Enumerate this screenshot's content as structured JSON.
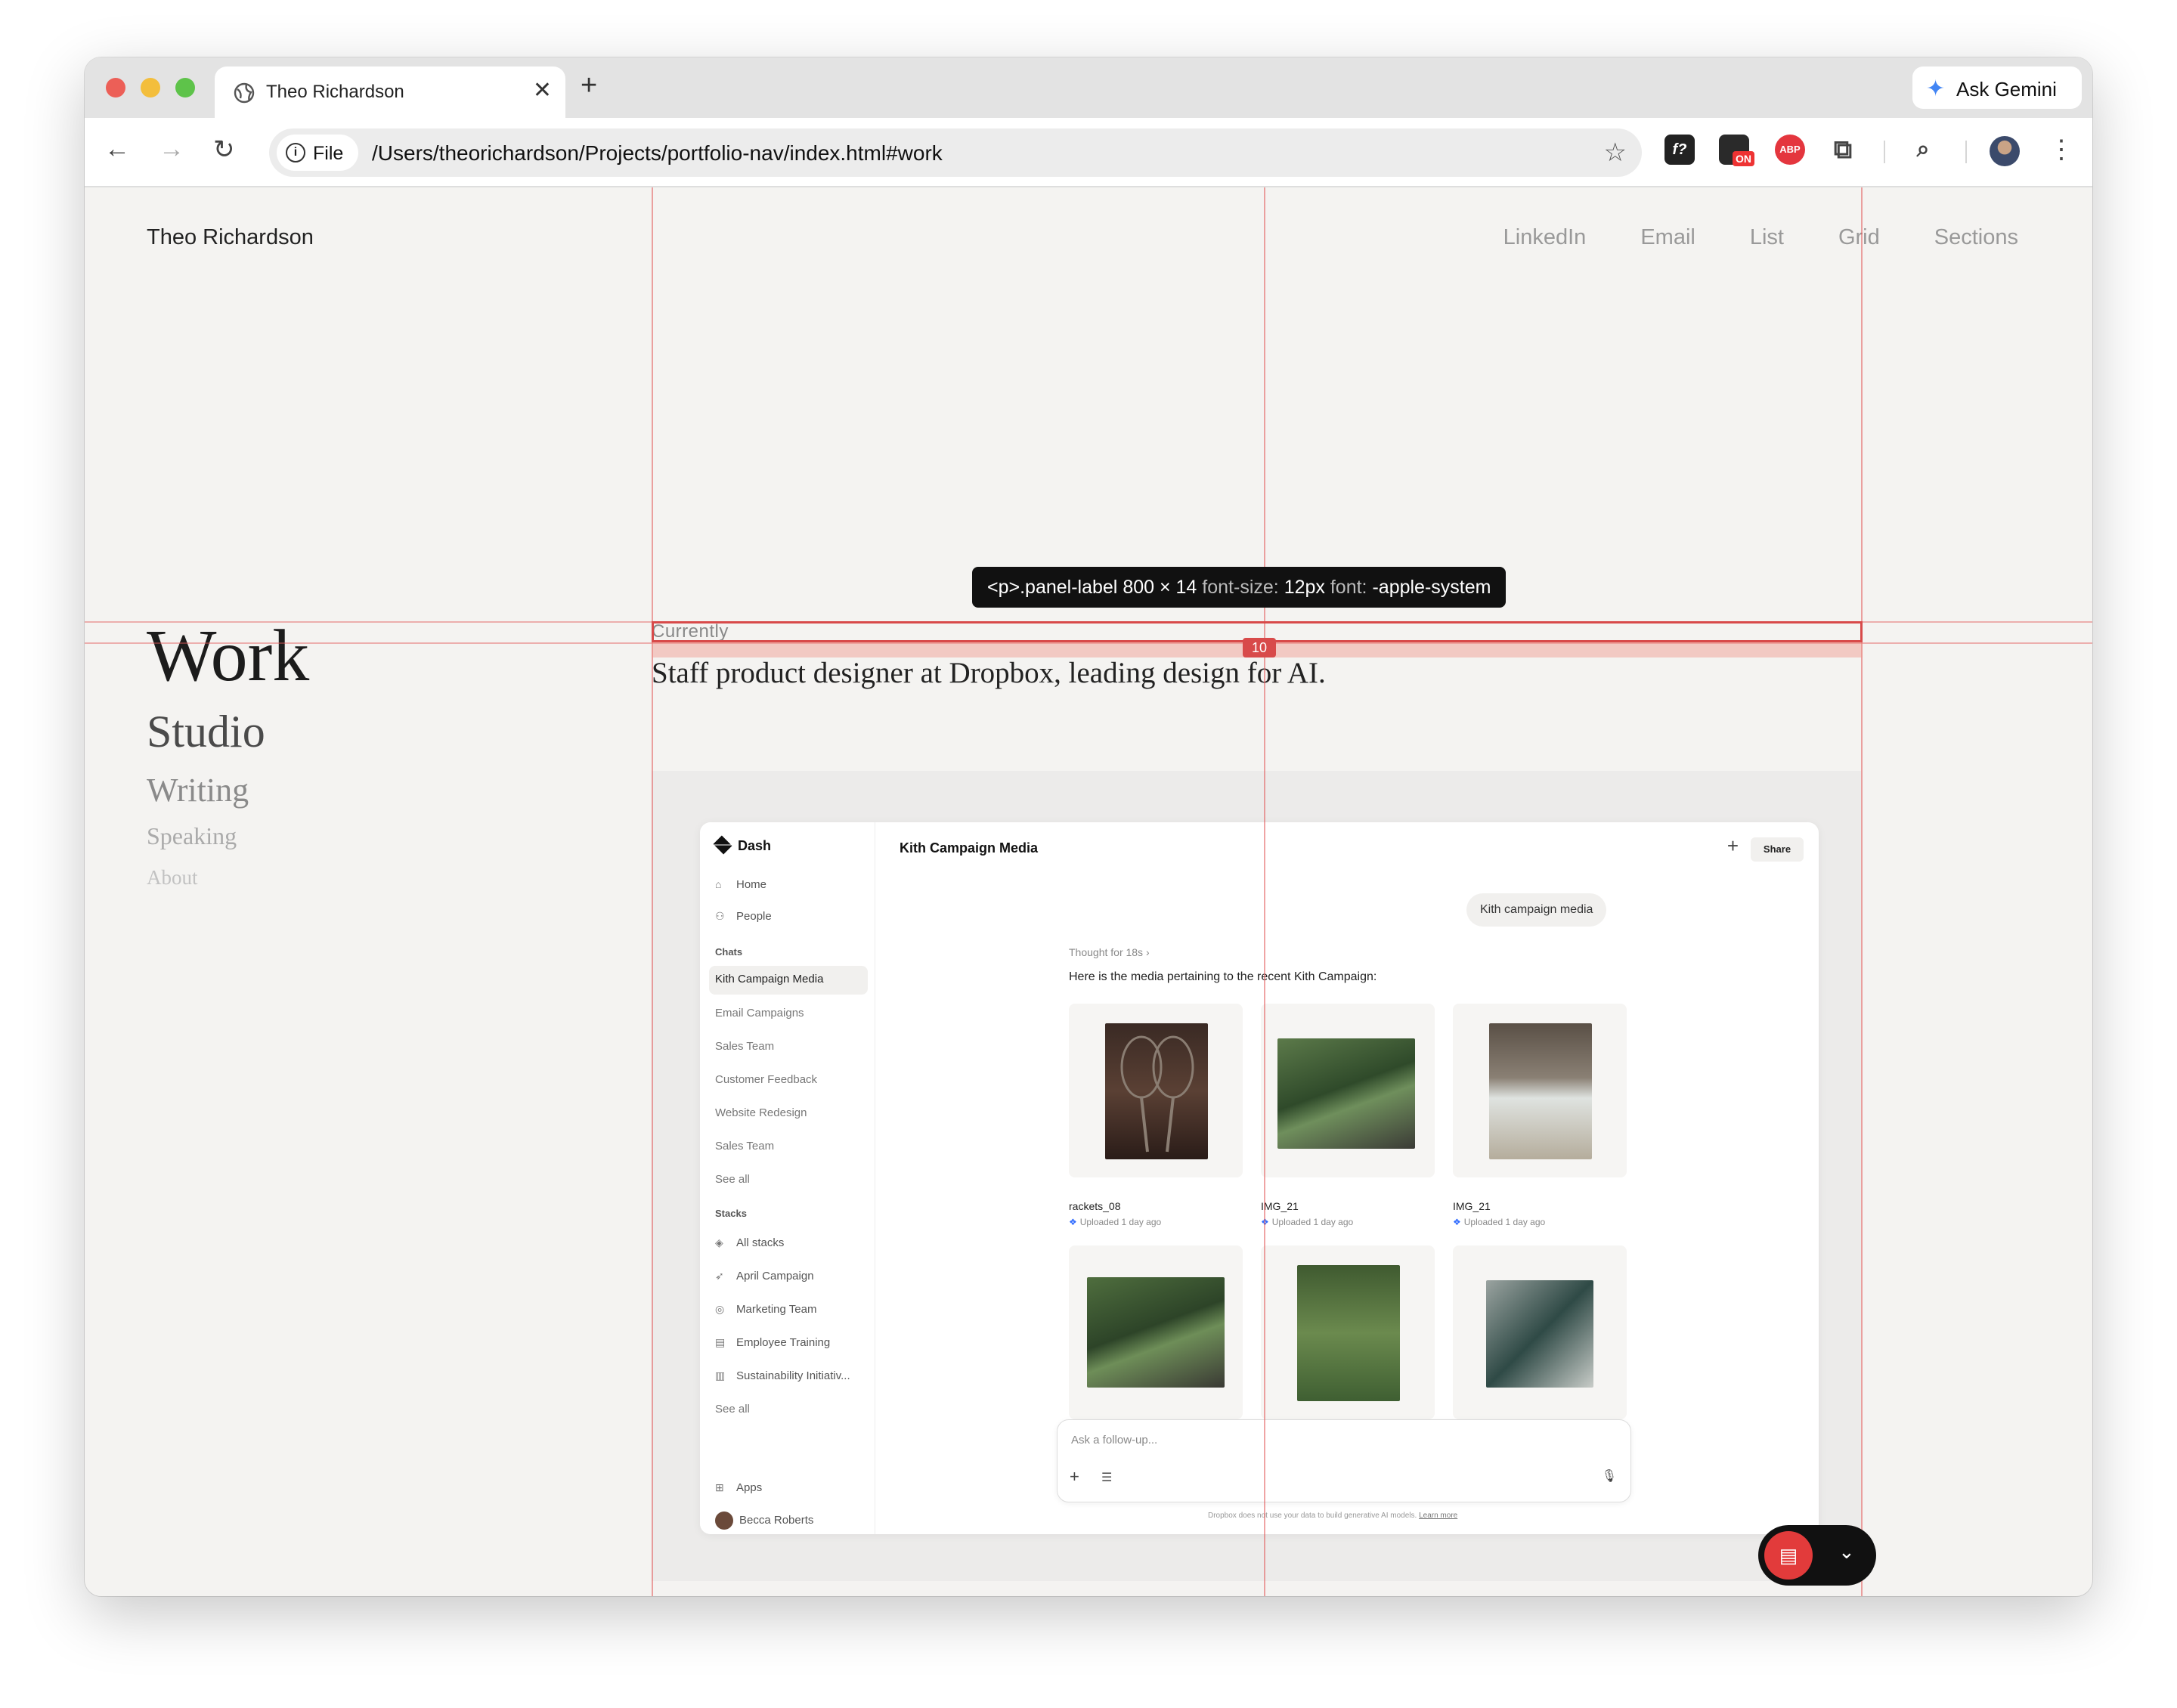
{
  "browser": {
    "tab_title": "Theo Richardson",
    "tab_close": "✕",
    "new_tab": "+",
    "gemini_label": "Ask Gemini",
    "file_chip": "File",
    "url": "/Users/theorichardson/Projects/portfolio-nav/index.html#work",
    "ext_on_badge": "ON",
    "ext_abp": "ABP"
  },
  "site": {
    "name": "Theo Richardson",
    "nav": [
      "LinkedIn",
      "Email",
      "List",
      "Grid",
      "Sections"
    ]
  },
  "side_nav": {
    "work": "Work",
    "studio": "Studio",
    "writing": "Writing",
    "speaking": "Speaking",
    "about": "About"
  },
  "panel": {
    "label": "Currently",
    "text": "Staff product designer at Dropbox, leading design for AI."
  },
  "overlay": {
    "tooltip_selector": "<p>.panel-label",
    "tooltip_size": "800 × 14",
    "tooltip_fs_key": "font-size:",
    "tooltip_fs_val": "12px",
    "tooltip_font_key": "font:",
    "tooltip_font_val": "-apple-system",
    "badge": "10"
  },
  "app": {
    "brand": "Dash",
    "nav": [
      {
        "icon": "⌂",
        "label": "Home"
      },
      {
        "icon": "⚇",
        "label": "People"
      }
    ],
    "chats_heading": "Chats",
    "chats": [
      "Kith Campaign Media",
      "Email Campaigns",
      "Sales Team",
      "Customer Feedback",
      "Website Redesign",
      "Sales Team",
      "See all"
    ],
    "stacks_heading": "Stacks",
    "stacks": [
      {
        "icon": "◈",
        "label": "All stacks"
      },
      {
        "icon": "➶",
        "label": "April Campaign"
      },
      {
        "icon": "◎",
        "label": "Marketing Team"
      },
      {
        "icon": "▤",
        "label": "Employee Training"
      },
      {
        "icon": "▥",
        "label": "Sustainability Initiativ..."
      }
    ],
    "stacks_see_all": "See all",
    "apps": "Apps",
    "user": "Becca Roberts",
    "title": "Kith Campaign Media",
    "share": "Share",
    "user_message": "Kith campaign media",
    "thought": "Thought for 18s  ›",
    "answer": "Here is the media pertaining to the recent Kith Campaign:",
    "media": [
      {
        "name": "rackets_08",
        "meta": "Uploaded 1 day ago"
      },
      {
        "name": "IMG_21",
        "meta": "Uploaded 1 day ago"
      },
      {
        "name": "IMG_21",
        "meta": "Uploaded 1 day ago"
      }
    ],
    "composer_placeholder": "Ask a follow-up...",
    "disclaimer": "Dropbox does not use your data to build generative AI models.",
    "disclaimer_link": "Learn more"
  }
}
